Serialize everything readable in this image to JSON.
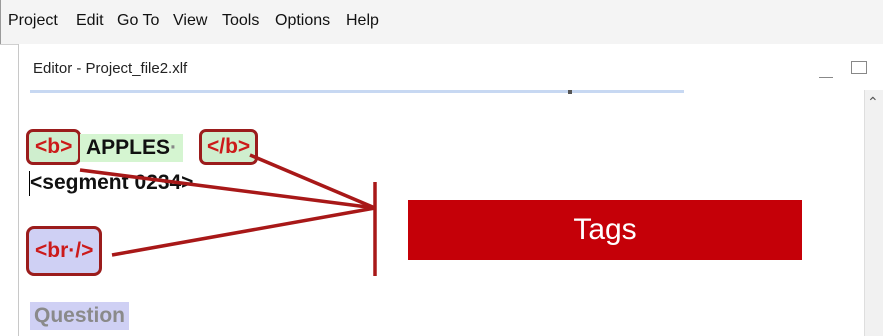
{
  "menubar": {
    "items": [
      "Project",
      "Edit",
      "Go To",
      "View",
      "Tools",
      "Options",
      "Help"
    ]
  },
  "editor": {
    "title": "Editor - Project_file2.xlf"
  },
  "content": {
    "tag_b_open": "<b>",
    "apples": "APPLES",
    "apples_dot": "·",
    "tag_b_close": "</b>",
    "segment": "<segment 0234>",
    "tag_br": "<br·/>",
    "question": "Question"
  },
  "callout": {
    "label": "Tags"
  },
  "colors": {
    "tag_border": "#9b1c1c",
    "tag_text": "#cc1a1a",
    "callout_bg": "#c50008",
    "green_highlight": "#cfeece",
    "blue_highlight": "#cfd0f4"
  }
}
